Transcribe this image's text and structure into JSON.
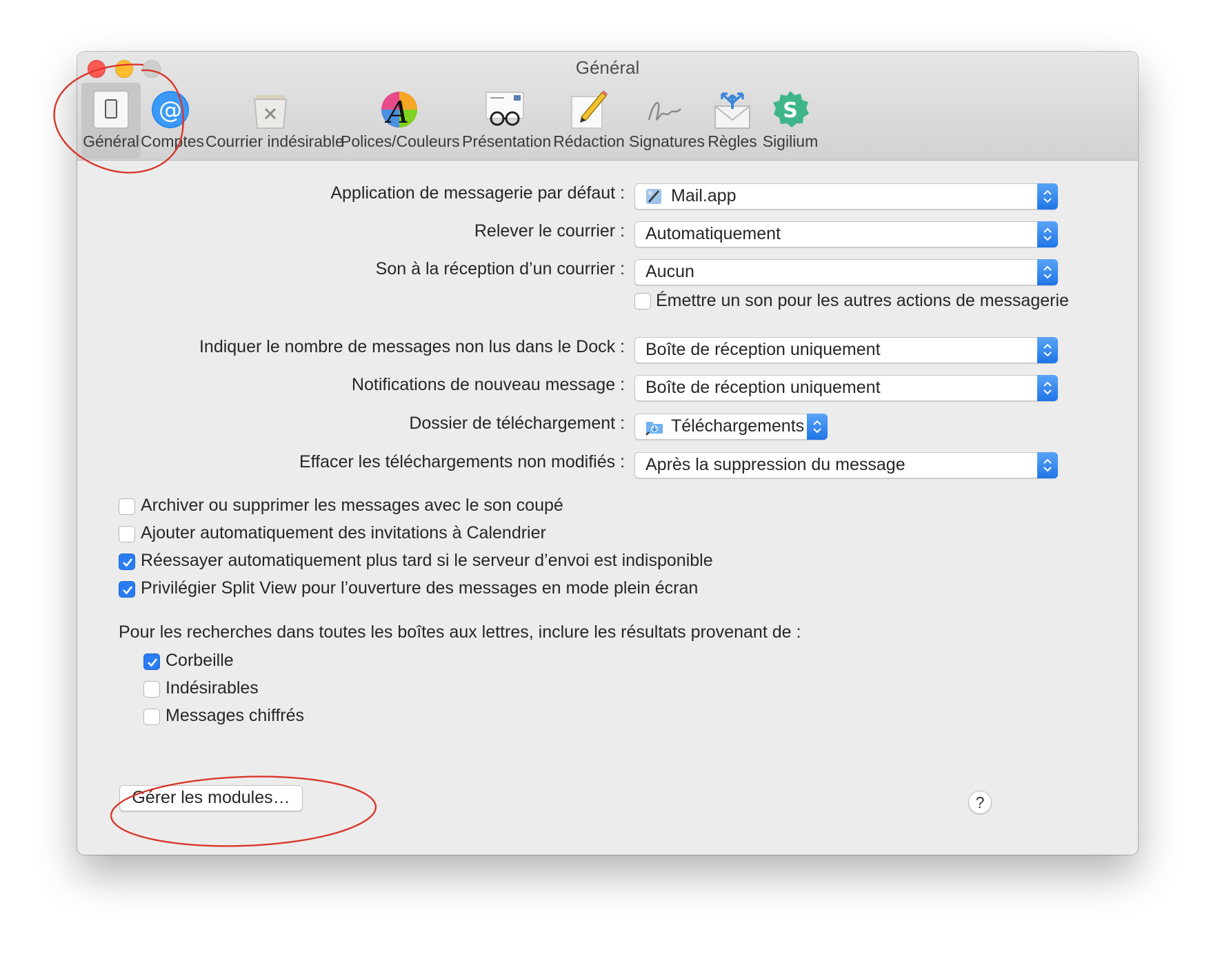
{
  "window": {
    "title": "Général"
  },
  "toolbar": {
    "items": [
      {
        "label": "Général",
        "icon": "switch-icon",
        "selected": true
      },
      {
        "label": "Comptes",
        "icon": "at-icon"
      },
      {
        "label": "Courrier indésirable",
        "icon": "junk-bin-icon"
      },
      {
        "label": "Polices/Couleurs",
        "icon": "font-colors-icon"
      },
      {
        "label": "Présentation",
        "icon": "glasses-icon"
      },
      {
        "label": "Rédaction",
        "icon": "pencil-icon"
      },
      {
        "label": "Signatures",
        "icon": "signature-icon"
      },
      {
        "label": "Règles",
        "icon": "rules-icon"
      },
      {
        "label": "Sigilium",
        "icon": "sigilium-icon"
      }
    ]
  },
  "settings": {
    "default_app": {
      "label": "Application de messagerie par défaut :",
      "value": "Mail.app"
    },
    "check_mail": {
      "label": "Relever le courrier :",
      "value": "Automatiquement"
    },
    "sound": {
      "label": "Son à la réception d’un courrier :",
      "value": "Aucun"
    },
    "play_sounds": {
      "label": "Émettre un son pour les autres actions de messagerie",
      "checked": false
    },
    "dock_unread": {
      "label": "Indiquer le nombre de messages non lus dans le Dock :",
      "value": "Boîte de réception uniquement"
    },
    "notifications": {
      "label": "Notifications de nouveau message :",
      "value": "Boîte de réception uniquement"
    },
    "downloads_folder": {
      "label": "Dossier de téléchargement :",
      "value": "Téléchargements"
    },
    "remove_downloads": {
      "label": "Effacer les téléchargements non modifiés :",
      "value": "Après la suppression du message"
    }
  },
  "options": [
    {
      "label": "Archiver ou supprimer les messages avec le son coupé",
      "checked": false
    },
    {
      "label": "Ajouter automatiquement des invitations à Calendrier",
      "checked": false
    },
    {
      "label": "Réessayer automatiquement plus tard si le serveur d’envoi est indisponible",
      "checked": true
    },
    {
      "label": "Privilégier Split View pour l’ouverture des messages en mode plein écran",
      "checked": true
    }
  ],
  "search": {
    "heading": "Pour les recherches dans toutes les boîtes aux lettres, inclure les résultats provenant de :",
    "items": [
      {
        "label": "Corbeille",
        "checked": true
      },
      {
        "label": "Indésirables",
        "checked": false
      },
      {
        "label": "Messages chiffrés",
        "checked": false
      }
    ]
  },
  "buttons": {
    "manage_plugins": "Gérer les modules…",
    "help": "?"
  },
  "colors": {
    "accent": "#2a7cf2",
    "annotation": "#d9362b"
  }
}
